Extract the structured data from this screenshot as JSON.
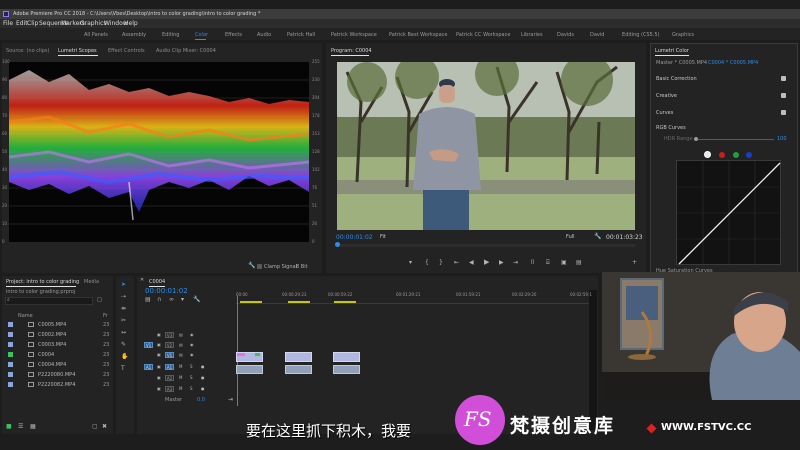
{
  "window": {
    "app_title": "Adobe Premiere Pro CC 2018 - C:\\Users\\Vbes\\Desktop\\intro to color grading\\intro to color grading *"
  },
  "menu": [
    "File",
    "Edit",
    "Clip",
    "Sequence",
    "Markers",
    "Graphics",
    "Window",
    "Help"
  ],
  "workspaces": [
    "All Panels",
    "Assembly",
    "Editing",
    "Color",
    "Effects",
    "Audio",
    "Patrick Hall",
    "Patrick Workspace",
    "Patrick Best Workspace",
    "Patrick CC Workspace",
    "Libraries",
    "Davids",
    "David",
    "Editing (CS5.5)",
    "Graphics"
  ],
  "workspace_active": "Color",
  "source_tabs": [
    "Source: (no clips)",
    "Lumetri Scopes",
    "Effect Controls",
    "Audio Clip Mixer: C0004"
  ],
  "scopes": {
    "left_ticks": [
      "100",
      "90",
      "80",
      "70",
      "60",
      "50",
      "40",
      "30",
      "20",
      "10",
      "0"
    ],
    "right_ticks": [
      "255",
      "230",
      "204",
      "178",
      "153",
      "128",
      "102",
      "76",
      "51",
      "26",
      "0"
    ],
    "clamp_label": "Clamp Signal",
    "bit_label": "8 Bit"
  },
  "program": {
    "tab": "Program: C0004",
    "timecode_left": "00:00:01:02",
    "fit_label": "Fit",
    "full_label": "Full",
    "timecode_right": "00:01:03:23"
  },
  "lumetri": {
    "tab": "Lumetri Color",
    "master": "Master * C0005.MP4",
    "clip": "C0004 * C0005.MP4",
    "sections": [
      "Basic Correction",
      "Creative",
      "Curves"
    ],
    "rgb_curves": "RGB Curves",
    "hdr_range": "HDR Range",
    "hdr_value": "100",
    "hue_sat": "Hue Saturation Curves"
  },
  "project": {
    "tab": "Project: intro to color grading",
    "media_tab": "Media",
    "file_label": "intro to color grading.prproj",
    "col_name": "Name",
    "col_fr": "Fr",
    "items": [
      {
        "name": "C0005.MP4",
        "fr": "23",
        "color": "#8aa6d8"
      },
      {
        "name": "C0002.MP4",
        "fr": "23",
        "color": "#8aa6d8"
      },
      {
        "name": "C0003.MP4",
        "fr": "23",
        "color": "#8aa6d8"
      },
      {
        "name": "C0004",
        "fr": "23",
        "color": "#3fbf5f"
      },
      {
        "name": "C0004.MP4",
        "fr": "23",
        "color": "#8aa6d8"
      },
      {
        "name": "P2220080.MP4",
        "fr": "23",
        "color": "#8aa6d8"
      },
      {
        "name": "P2220082.MP4",
        "fr": "23",
        "color": "#8aa6d8"
      }
    ]
  },
  "timeline": {
    "tab": "C0004",
    "timecode": "00:00:01:02",
    "ruler": [
      "00:00",
      "00:00:29:23",
      "00:00:59:22",
      "00:01:29:21",
      "00:01:59:21",
      "00:02:29:20",
      "00:02:59:1"
    ],
    "video_tracks": [
      "V3",
      "V2",
      "V1"
    ],
    "audio_tracks": [
      "A1",
      "A2",
      "A3"
    ],
    "master_label": "Master",
    "master_value": "0.0",
    "source_patch_v": "V1",
    "source_patch_a": "A1"
  },
  "subtitle": "要在这里抓下积木，我要",
  "watermark": {
    "logo": "FS",
    "brand": "梵摄创意库",
    "url": "WWW.FSTVC.CC"
  }
}
